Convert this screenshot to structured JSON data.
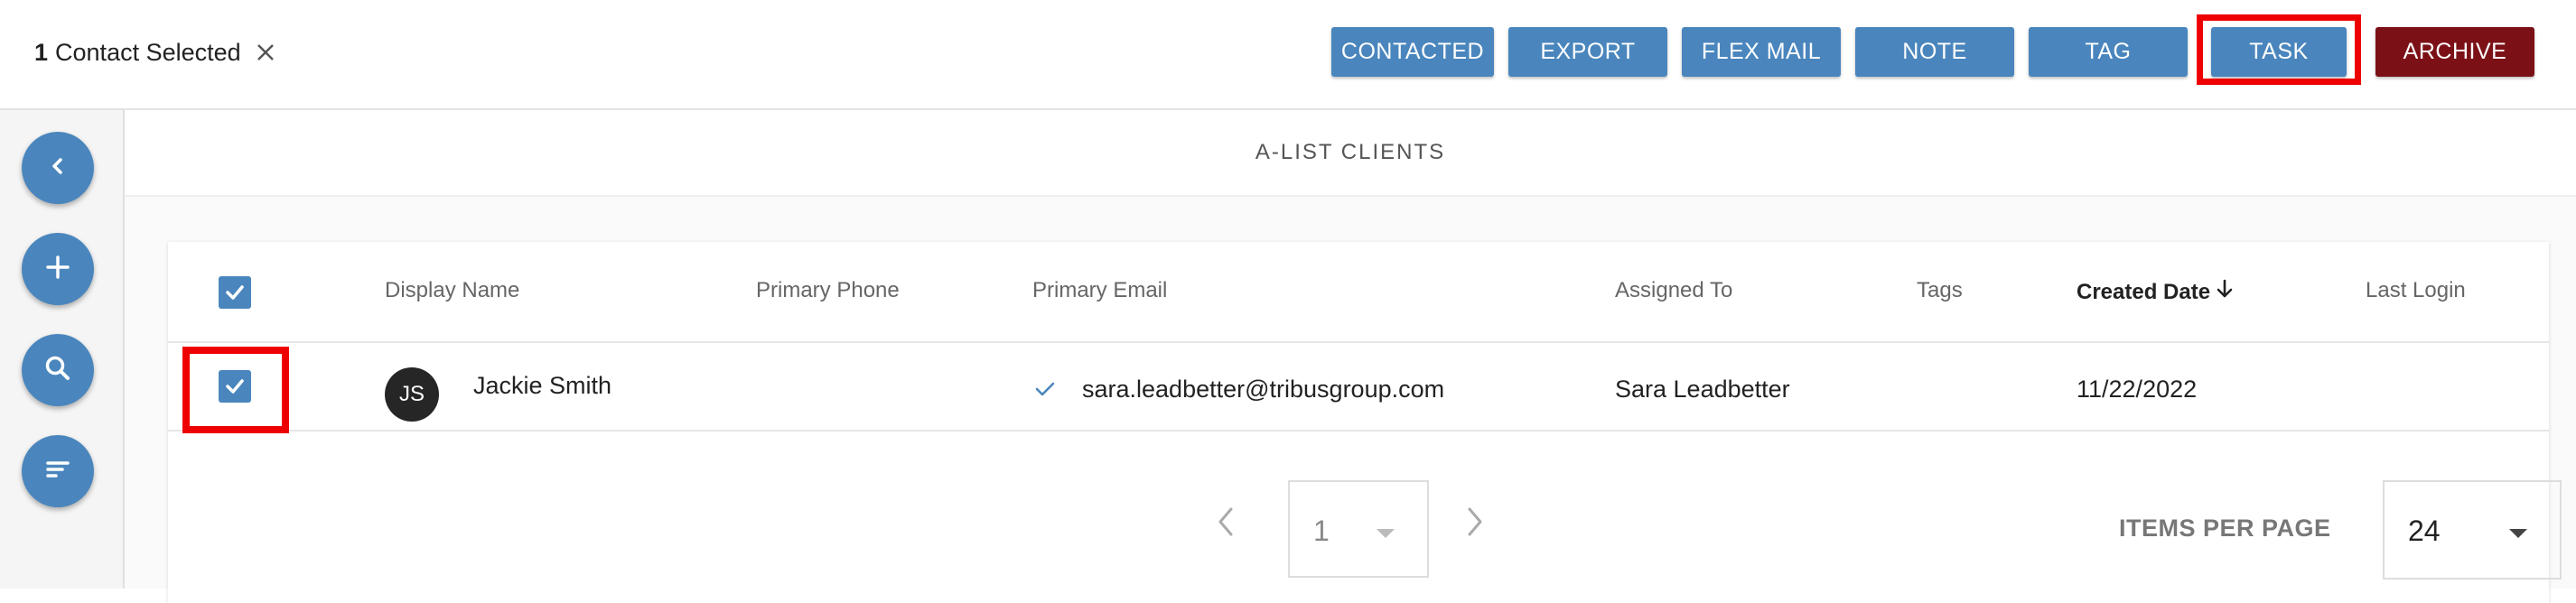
{
  "selection": {
    "count": "1",
    "label": "Contact Selected"
  },
  "toolbar": {
    "contacted": "CONTACTED",
    "export": "EXPORT",
    "flex_mail": "FLEX MAIL",
    "note": "NOTE",
    "tag": "TAG",
    "task": "TASK",
    "archive": "ARCHIVE"
  },
  "rail": {
    "icons": [
      "chevron-left-icon",
      "plus-icon",
      "search-icon",
      "sort-icon"
    ]
  },
  "list": {
    "title": "A-LIST CLIENTS"
  },
  "table": {
    "columns": [
      "Display Name",
      "Primary Phone",
      "Primary Email",
      "Assigned To",
      "Tags",
      "Created Date",
      "Last Login"
    ],
    "sort_column": "Created Date",
    "sort_direction": "descending",
    "rows": [
      {
        "selected": true,
        "initials": "JS",
        "display_name": "Jackie Smith",
        "primary_phone": "",
        "primary_email": "sara.leadbetter@tribusgroup.com",
        "email_verified": true,
        "assigned_to": "Sara Leadbetter",
        "tags": "",
        "created_date": "11/22/2022",
        "last_login": ""
      }
    ]
  },
  "pagination": {
    "page": "1",
    "items_per_page_label": "ITEMS PER PAGE",
    "items_per_page": "24"
  },
  "colors": {
    "primary": "#4a86bd",
    "archive": "#7b1116",
    "highlight": "#ee0000",
    "avatar": "#262626"
  }
}
